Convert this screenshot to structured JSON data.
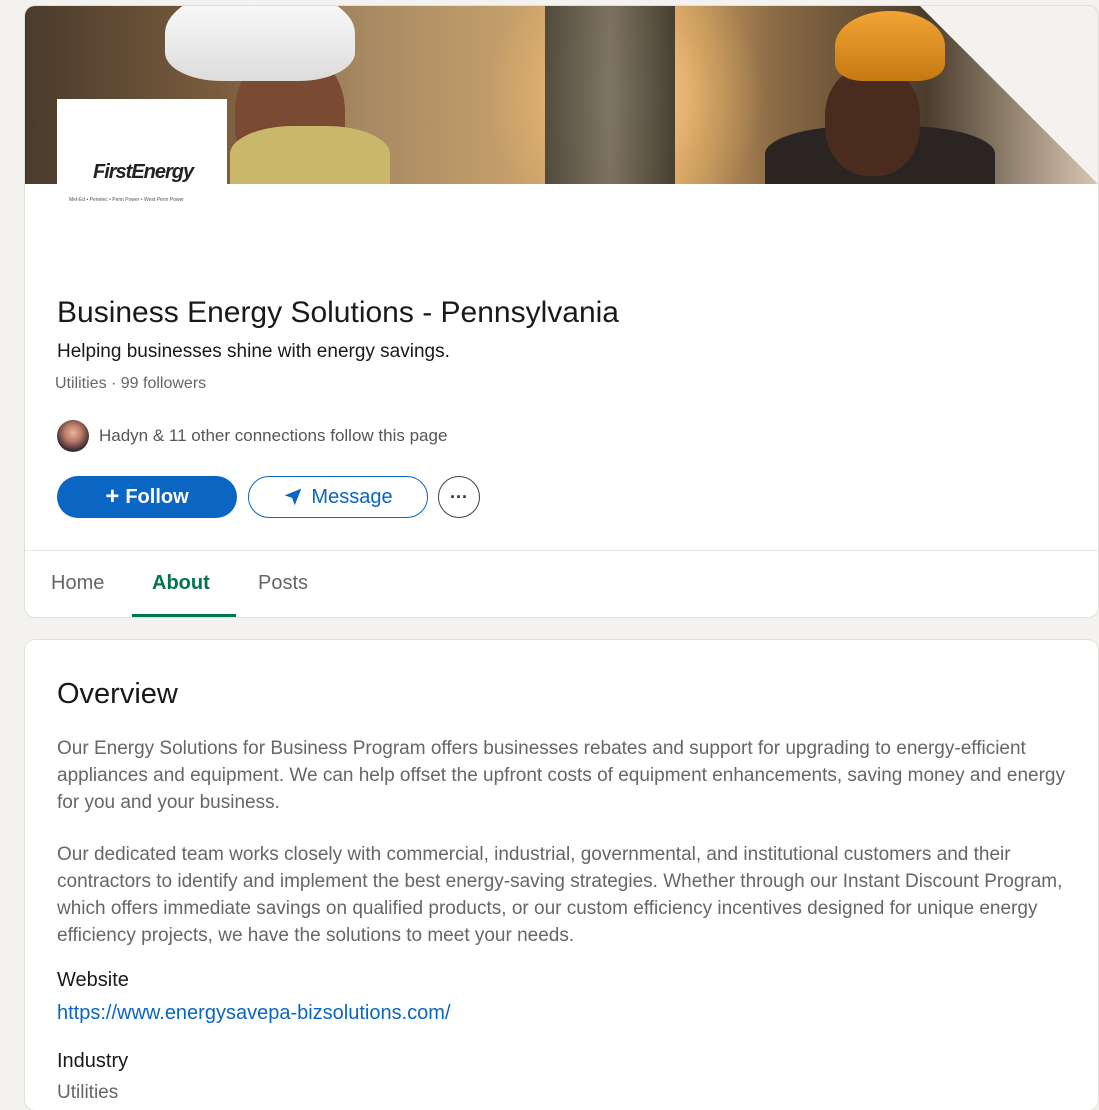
{
  "company": {
    "logo_text": "FirstEnergy",
    "logo_subtext": "Met-Ed • Penelec • Penn Power • West Penn Power",
    "name": "Business Energy Solutions - Pennsylvania",
    "tagline": "Helping businesses shine with energy savings.",
    "meta": "Utilities · 99 followers",
    "connections_text": "Hadyn & 11 other connections follow this page"
  },
  "actions": {
    "follow_label": "Follow",
    "message_label": "Message",
    "more_label": "···"
  },
  "tabs": [
    {
      "label": "Home",
      "active": false
    },
    {
      "label": "About",
      "active": true
    },
    {
      "label": "Posts",
      "active": false
    }
  ],
  "about": {
    "title": "Overview",
    "paragraphs": [
      "Our Energy Solutions for Business Program offers businesses rebates and support for upgrading to energy-efficient appliances and equipment. We can help offset the upfront costs of equipment enhancements, saving money and energy for you and your business.",
      "Our dedicated team works closely with commercial, industrial, governmental, and institutional customers and their contractors to identify and implement the best energy-saving strategies. Whether through our Instant Discount Program, which offers immediate savings on qualified products, or our custom efficiency incentives designed for unique energy efficiency projects, we have the solutions to meet your needs."
    ],
    "website_label": "Website",
    "website_url": "https://www.energysavepa-bizsolutions.com/",
    "industry_label": "Industry",
    "industry_value": "Utilities"
  },
  "colors": {
    "primary": "#0a66c2",
    "active_tab": "#01754f",
    "page_bg": "#f4f2ee"
  }
}
